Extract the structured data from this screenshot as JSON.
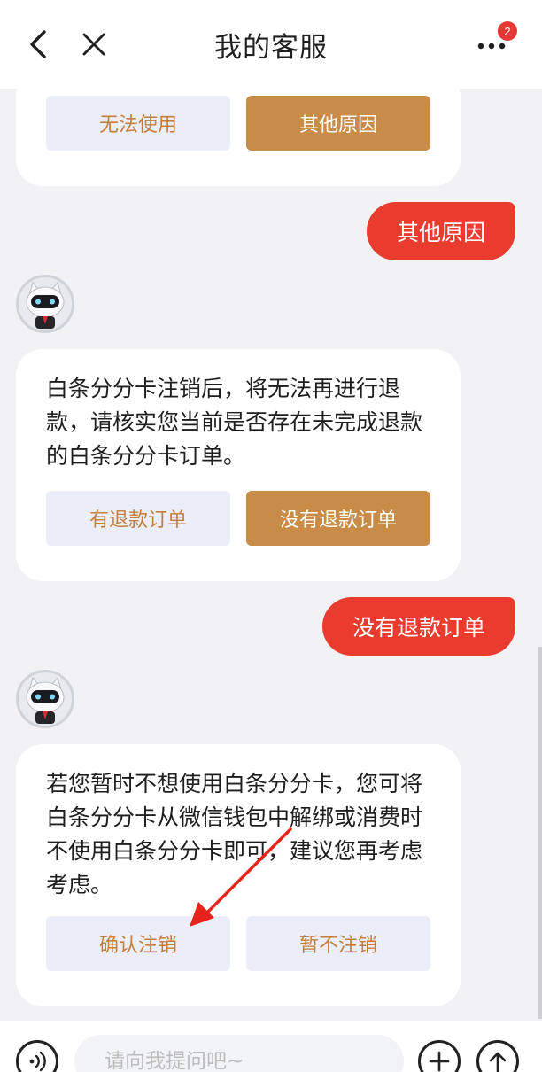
{
  "header": {
    "title": "我的客服",
    "notification_count": "2"
  },
  "messages": {
    "card1": {
      "options": [
        "无法使用",
        "其他原因"
      ]
    },
    "user_reply1": "其他原因",
    "card2": {
      "text": "白条分分卡注销后，将无法再进行退款，请核实您当前是否存在未完成退款的白条分分卡订单。",
      "options": [
        "有退款订单",
        "没有退款订单"
      ]
    },
    "user_reply2": "没有退款订单",
    "card3": {
      "text": "若您暂时不想使用白条分分卡，您可将白条分分卡从微信钱包中解绑或消费时不使用白条分分卡即可，建议您再考虑考虑。",
      "options": [
        "确认注销",
        "暂不注销"
      ]
    }
  },
  "input": {
    "placeholder": "请向我提问吧~"
  },
  "colors": {
    "accent_orange": "#c98c48",
    "user_bubble": "#e93b2e",
    "annotation_arrow": "#e8231c"
  }
}
